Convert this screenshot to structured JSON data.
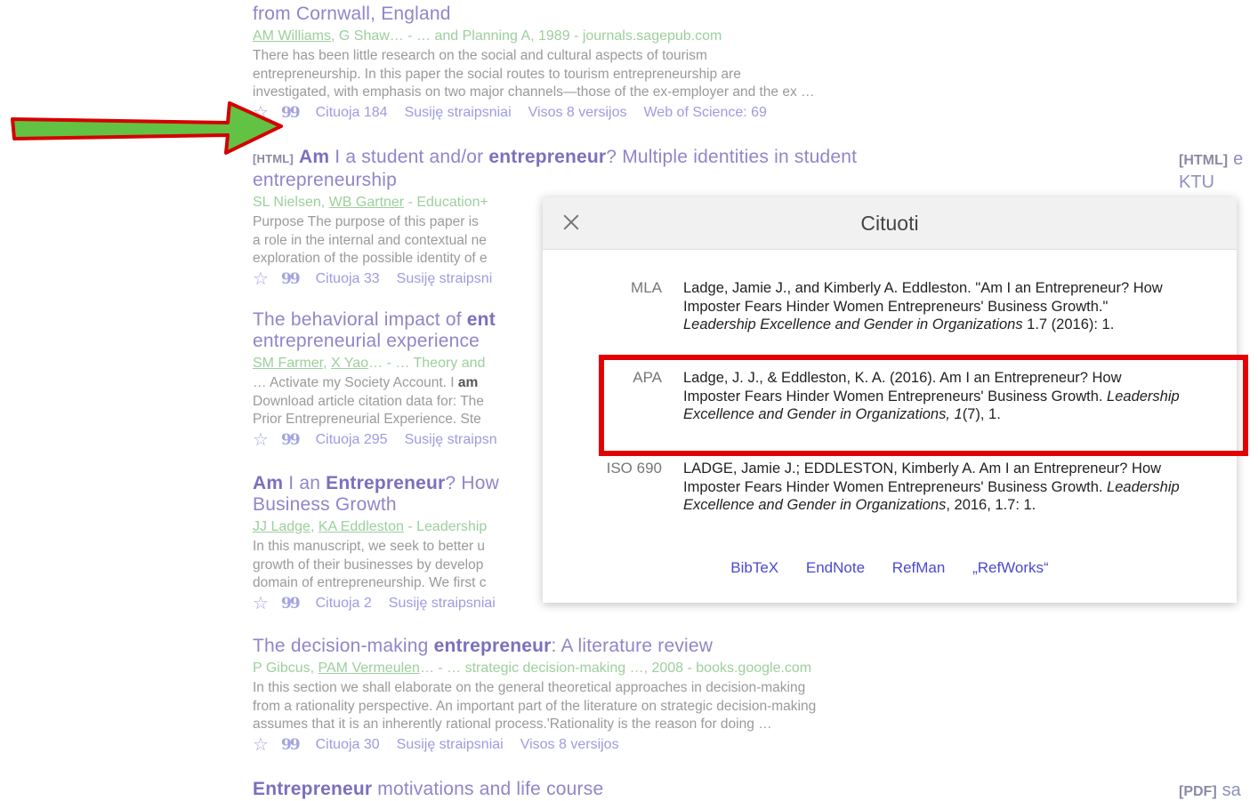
{
  "results": [
    {
      "title_tail": "from Cornwall, England",
      "meta_author1": "AM Williams",
      "meta_rest": ", G Shaw… - … and Planning A, 1989 - journals.sagepub.com",
      "snippet": [
        "There has been little research on the social and cultural aspects of tourism",
        "entrepreneurship. In this paper the social routes to tourism entrepreneurship are",
        "investigated, with emphasis on two major channels—those of the ex-employer and the ex …"
      ],
      "actions": [
        "Cituoja 184",
        "Susiję straipsniai",
        "Visos 8 versijos",
        "Web of Science: 69"
      ]
    },
    {
      "tag": "[HTML]",
      "title_b1": "Am",
      "title_p1": " I a student and/or ",
      "title_b2": "entrepreneur",
      "title_p2": "? Multiple identities in student",
      "title_line2": "entrepreneurship",
      "meta_a": "SL Nielsen, ",
      "meta_u": "WB Gartner",
      "meta_rest": " - Education+",
      "snippet": [
        "Purpose The purpose of this paper is",
        "a role in the internal and contextual ne",
        "exploration of the possible identity of e"
      ],
      "actions": [
        "Cituoja 33",
        "Susiję straipsni"
      ]
    },
    {
      "title_p1": "The behavioral impact of ",
      "title_b1": "ent",
      "title_line2": "entrepreneurial experience",
      "meta_u1": "SM Farmer",
      "meta_mid": ", ",
      "meta_u2": "X Yao",
      "meta_rest": "… - … Theory and",
      "snippet1_a": "… Activate my Society Account. I ",
      "snippet1_b": "am",
      "snippet": [
        "Download article citation data for: The",
        "Prior Entrepreneurial Experience. Ste"
      ],
      "actions": [
        "Cituoja 295",
        "Susiję straipsn"
      ]
    },
    {
      "title_b1": "Am",
      "title_p1": " I an ",
      "title_b2": "Entrepreneur",
      "title_p2": "? How",
      "title_line2": "Business Growth",
      "meta_u1": "JJ Ladge",
      "meta_mid": ", ",
      "meta_u2": "KA Eddleston",
      "meta_rest": " - Leadership",
      "snippet": [
        "In this manuscript, we seek to better u",
        "growth of their businesses by develop",
        "domain of entrepreneurship. We first c"
      ],
      "actions": [
        "Cituoja 2",
        "Susiję straipsniai"
      ]
    },
    {
      "title_p1": "The decision-making ",
      "title_b1": "entrepreneur",
      "title_p2": ": A literature review",
      "meta_a": "P Gibcus, ",
      "meta_u": "PAM Vermeulen",
      "meta_rest": "… - … strategic decision-making …, 2008 - books.google.com",
      "snippet": [
        "In this section we shall elaborate on the general theoretical approaches in decision-making",
        "from a rationality perspective. An important part of the literature on strategic decision-making",
        "assumes that it is an inherently rational process.'Rationality is the reason for doing …"
      ],
      "actions": [
        "Cituoja 30",
        "Susiję straipsniai",
        "Visos 8 versijos"
      ]
    },
    {
      "title_b1": "Entrepreneur",
      "title_p1": " motivations and life course"
    }
  ],
  "side_links": {
    "html_tag": "[HTML]",
    "html_letter": "e",
    "ktu": "KTU",
    "pdf_tag": "[PDF]",
    "pdf_text": "sa"
  },
  "icons": {
    "star": "☆",
    "quote": "99"
  },
  "modal": {
    "title": "Cituoti",
    "citations": [
      {
        "label": "MLA",
        "text_a": "Ladge, Jamie J., and Kimberly A. Eddleston. \"Am I an Entrepreneur? How Imposter Fears Hinder Women Entrepreneurs' Business Growth.\" ",
        "text_i": "Leadership Excellence and Gender in Organizations",
        "text_b": " 1.7 (2016): 1."
      },
      {
        "label": "APA",
        "text_a": "Ladge, J. J., & Eddleston, K. A. (2016). Am I an Entrepreneur? How Imposter Fears Hinder Women Entrepreneurs' Business Growth. ",
        "text_i": "Leadership Excellence and Gender in Organizations, 1",
        "text_b": "(7), 1."
      },
      {
        "label": "ISO 690",
        "text_a": "LADGE, Jamie J.; EDDLESTON, Kimberly A. Am I an Entrepreneur? How Imposter Fears Hinder Women Entrepreneurs' Business Growth. ",
        "text_i": "Leadership Excellence and Gender in Organizations",
        "text_b": ", 2016, 1.7: 1."
      }
    ],
    "exports": [
      "BibTeX",
      "EndNote",
      "RefMan",
      "„RefWorks“"
    ]
  },
  "colors": {
    "highlight": "#e30000",
    "arrow_fill": "#62c244",
    "arrow_stroke": "#d40000"
  }
}
